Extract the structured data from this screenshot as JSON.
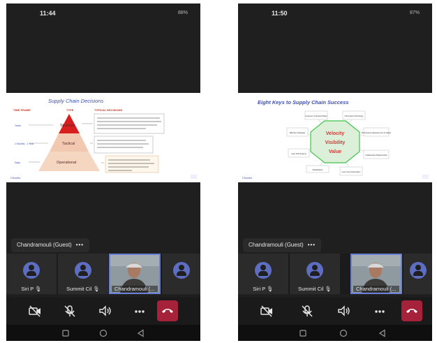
{
  "screens": [
    {
      "status": {
        "time": "11:44",
        "battery": "88%"
      },
      "slide": {
        "title": "Supply Chain Decisions",
        "header_time_frame": "TIME FRAME",
        "header_type": "TYPE",
        "header_typical": "TYPICAL DECISIONS",
        "levels": [
          "Strategic",
          "Tactical",
          "Operational"
        ],
        "time_labels": [
          "Years",
          "1 Months - 1 Year",
          "Daily"
        ],
        "footer_logo": "Chandra"
      },
      "chip": {
        "name": "Chandramouli (Guest)",
        "more": "•••"
      },
      "tiles": [
        {
          "label": "Siri P 🎙"
        },
        {
          "label": "Summit Cil 🎙"
        },
        {
          "label": "Chandramouli (..."
        }
      ]
    },
    {
      "status": {
        "time": "11:50",
        "battery": "87%"
      },
      "slide": {
        "title": "Eight Keys to Supply Chain Success",
        "center_words": [
          "Velocity",
          "Visibility",
          "Value"
        ],
        "keys": [
          "Customer & Demand Mgmt",
          "Information Technology",
          "Effective Strategies",
          "Performance Measurement & Values",
          "Lean Pull Systems",
          "Collaborative Relationships",
          "Globalization",
          "Lean Cost Optimization"
        ],
        "footer_logo": "Chandra"
      },
      "chip": {
        "name": "Chandramouli (Guest)",
        "more": "•••"
      },
      "tiles": [
        {
          "label": "Siri P 🎙"
        },
        {
          "label": "Summit Cil 🎙"
        },
        {
          "label": "Chandramouli (..."
        }
      ]
    }
  ],
  "controls": [
    "camera-off-icon",
    "mic-off-icon",
    "speaker-icon",
    "more-icon",
    "end-call-icon"
  ],
  "colors": {
    "accent": "#5d6ec2",
    "end_call": "#a6213a",
    "velocity_green": "#3fc44a"
  }
}
